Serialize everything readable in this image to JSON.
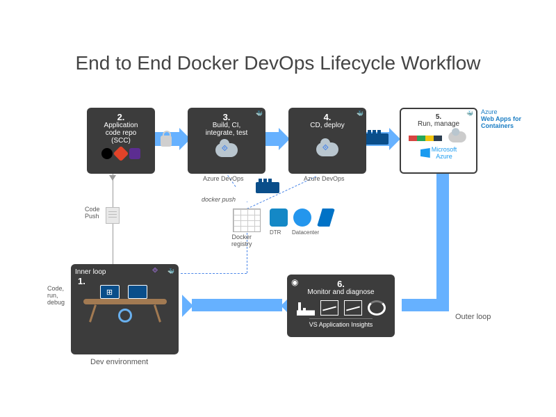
{
  "title": "End to End Docker DevOps Lifecycle Workflow",
  "stages": {
    "s1": {
      "number": "1.",
      "labelA": "Inner loop",
      "sublabel": "Dev environment"
    },
    "s2": {
      "number": "2.",
      "line1": "Application",
      "line2": "code repo",
      "line3": "(SCC)"
    },
    "s3": {
      "number": "3.",
      "line1": "Build, CI,",
      "line2": "integrate, test",
      "subbrand": "Azure DevOps"
    },
    "s4": {
      "number": "4.",
      "line1": "CD, deploy",
      "subbrand": "Azure DevOps"
    },
    "s5": {
      "number": "5.",
      "line1": "Run, manage",
      "brand1": "Microsoft",
      "brand2": "Azure",
      "sidenote1": "Azure",
      "sidenote2": "Web Apps for",
      "sidenote3": "Containers"
    },
    "s6": {
      "number": "6.",
      "line1": "Monitor and diagnose",
      "foot": "VS Application Insights"
    }
  },
  "labels": {
    "code_push": "Code\nPush",
    "docker_push": "docker push",
    "docker_registry": "Docker\nregistry",
    "outer_loop": "Outer loop",
    "inner_side": "Code,\nrun,\ndebug",
    "dtr": "DTR",
    "datacenter": "Datacenter"
  }
}
